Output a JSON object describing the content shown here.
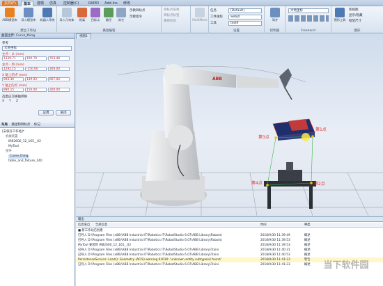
{
  "tabs": {
    "file": "文件(F)",
    "items": [
      "基本",
      "建模",
      "仿真",
      "控制器(C)",
      "RAPID",
      "Add-Ins",
      "修改"
    ]
  },
  "ribbon": {
    "g1": {
      "b1": "ABB模型库",
      "b2": "导入模型库",
      "b3": "机器人系统",
      "label": "建立工作站"
    },
    "g2": {
      "b1": "导入几何体",
      "b2": "框架",
      "b3": "目标点",
      "b4": "路径",
      "b5": "其它",
      "b6": "示教目标点",
      "b7": "示教指令",
      "label": "路径编程"
    },
    "g3": {
      "s1": "目标点名称",
      "s2": "目标点标签",
      "s3": "路径标签",
      "multimove": "MultiMove"
    },
    "g4": {
      "task_lbl": "任务",
      "task": "(Default)",
      "wobj_lbl": "工件坐标",
      "wobj": "wobj0",
      "tool_lbl": "工具",
      "tool": "tool0",
      "label": "设置"
    },
    "g5": {
      "sync": "同步",
      "label": "控制器"
    },
    "g6": {
      "coord": "大地坐标",
      "label": "Freehand"
    },
    "g7": {
      "b1": "图形工具",
      "s1": "新视图",
      "s2": "显示/隐藏",
      "s3": "框架尺寸",
      "label": "图形"
    }
  },
  "leftpanel": {
    "title": "曲面边界: Curve_thing",
    "section": "参考",
    "ref": "大地坐标",
    "p1": "主点 - 从 (mm)",
    "p1v": [
      "1339.71",
      "190.79",
      "703.48"
    ],
    "p2": "主点 - 到 (mm)",
    "p2v": [
      "1292.15",
      "-150.00",
      "300.00"
    ],
    "p3": "X 轴上的点 (mm)",
    "p3v": [
      "944.30",
      "149.93",
      "667.04"
    ],
    "p4": "Y 轴上的点 (mm)",
    "p4v": [
      "880.15",
      "150.00",
      "300.00"
    ],
    "axis": "选着应交换轴转换",
    "x": "X",
    "y": "Y",
    "z": "Z",
    "apply": "应用",
    "close": "关闭"
  },
  "layout_panel": {
    "tabs": [
      "布局",
      "路径和目标点",
      "标记"
    ],
    "root": "[未保存工作站]*",
    "mech": "机械装置",
    "items": [
      "IRB2600_12_165__02",
      "MyTool",
      "部件",
      "Curve_thing",
      "table_and_fixture_140"
    ]
  },
  "viewport": {
    "tab": "视图1",
    "brand": "ABB",
    "p1": "第1点",
    "p2": "第2点",
    "p3": "第3点",
    "p4": "第4点"
  },
  "output": {
    "tab": "输出",
    "headers": [
      "信息来自",
      "全部信息",
      "时间",
      "种类"
    ],
    "rows": [
      {
        "msg": "■ 新工作站已创建",
        "time": "",
        "kind": ""
      },
      {
        "msg": "已导入 D:\\Program Files (x86)\\ABB Industrial IT\\Robotics IT\\RobotStudio 6.07\\ABB Library\\Robots\\",
        "time": "2018/9/30 11:39:49",
        "kind": "概述"
      },
      {
        "msg": "已导入 D:\\Program Files (x86)\\ABB Industrial IT\\Robotics IT\\RobotStudio 6.07\\ABB Library\\Robots\\",
        "time": "2018/9/30 11:39:53",
        "kind": "概述"
      },
      {
        "msg": "MyTool 安装到 IRB2600_12_165__02",
        "time": "2018/9/30 11:39:53",
        "kind": "概述"
      },
      {
        "msg": "已导入 D:\\Program Files (x86)\\ABB Industrial IT\\Robotics IT\\RobotStudio 6.07\\ABB Library\\Traini",
        "time": "2018/9/30 11:40:31",
        "kind": "概述"
      },
      {
        "msg": "已导入 D:\\Program Files (x86)\\ABB Industrial IT\\Robotics IT\\RobotStudio 6.07\\ABB Library\\Traini",
        "time": "2018/9/30 11:40:53",
        "kind": "概述"
      },
      {
        "msg": "PersistenceService: Load(): Geometry (ACIS) warning 63010: 'unknown entity subtype(s) found'",
        "time": "2018/9/30 11:41:23",
        "kind": "警告"
      },
      {
        "msg": "已导入 D:\\Program Files (x86)\\ABB Industrial IT\\Robotics IT\\RobotStudio 6.07\\ABB Library\\Traini",
        "time": "2018/9/30 11:41:23",
        "kind": "概述"
      }
    ],
    "watermark": "当下软件园"
  }
}
